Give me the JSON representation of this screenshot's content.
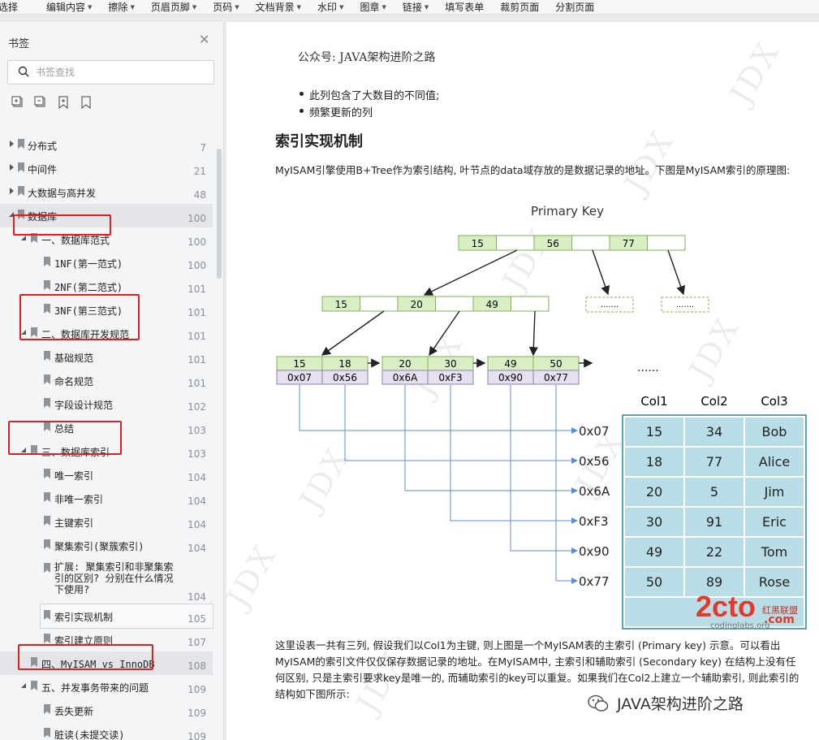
{
  "toolbar": {
    "items": [
      {
        "label": "选择",
        "caret": false
      },
      {
        "label": "编辑内容",
        "caret": true
      },
      {
        "label": "擦除",
        "caret": true
      },
      {
        "label": "页眉页脚",
        "caret": true
      },
      {
        "label": "页码",
        "caret": true
      },
      {
        "label": "文档背景",
        "caret": true
      },
      {
        "label": "水印",
        "caret": true
      },
      {
        "label": "图章",
        "caret": true
      },
      {
        "label": "链接",
        "caret": true
      },
      {
        "label": "填写表单",
        "caret": false
      },
      {
        "label": "裁剪页面",
        "caret": false
      },
      {
        "label": "分割页面",
        "caret": false
      }
    ]
  },
  "sidebar": {
    "title": "书签",
    "search_placeholder": "书签查找",
    "tools": [
      "expand-all-icon",
      "collapse-all-icon",
      "add-bookmark-icon",
      "delete-bookmark-icon"
    ],
    "items": [
      {
        "label": "分布式",
        "page": "7",
        "level": 0,
        "arrow": "right"
      },
      {
        "label": "中间件",
        "page": "21",
        "level": 0,
        "arrow": "right"
      },
      {
        "label": "大数据与高并发",
        "page": "48",
        "level": 0,
        "arrow": "right"
      },
      {
        "label": "数据库",
        "page": "100",
        "level": 0,
        "arrow": "down",
        "selected": true
      },
      {
        "label": "一、数据库范式",
        "page": "100",
        "level": 1,
        "arrow": "down"
      },
      {
        "label": "1NF(第一范式)",
        "page": "100",
        "level": 2
      },
      {
        "label": "2NF(第二范式)",
        "page": "101",
        "level": 2
      },
      {
        "label": "3NF(第三范式)",
        "page": "101",
        "level": 2
      },
      {
        "label": "二、数据库开发规范",
        "page": "101",
        "level": 1,
        "arrow": "down"
      },
      {
        "label": "基础规范",
        "page": "101",
        "level": 2
      },
      {
        "label": "命名规范",
        "page": "101",
        "level": 2
      },
      {
        "label": "字段设计规范",
        "page": "102",
        "level": 2
      },
      {
        "label": "总结",
        "page": "103",
        "level": 2
      },
      {
        "label": "三、数据库索引",
        "page": "103",
        "level": 1,
        "arrow": "down"
      },
      {
        "label": "唯一索引",
        "page": "104",
        "level": 2
      },
      {
        "label": "非唯一索引",
        "page": "104",
        "level": 2
      },
      {
        "label": "主键索引",
        "page": "104",
        "level": 2
      },
      {
        "label": "聚集索引(聚簇索引)",
        "page": "104",
        "level": 2
      },
      {
        "label": "扩展: 聚集索引和非聚集索引的区别? 分别在什么情况下使用?",
        "page": "104",
        "level": 2,
        "multi": true
      },
      {
        "label": "索引实现机制",
        "page": "105",
        "level": 2,
        "hover": true
      },
      {
        "label": "索引建立原则",
        "page": "107",
        "level": 2
      },
      {
        "label": "四、MyISAM vs InnoDB",
        "page": "108",
        "level": 1,
        "selected": true
      },
      {
        "label": "五、并发事务带来的问题",
        "page": "109",
        "level": 1,
        "arrow": "down"
      },
      {
        "label": "丢失更新",
        "page": "109",
        "level": 2
      },
      {
        "label": "脏读(未提交读)",
        "page": "109",
        "level": 2
      }
    ]
  },
  "page": {
    "account_line": "公众号: JAVA架构进阶之路",
    "bullets": [
      "此列包含了大数目的不同值;",
      "频繁更新的列"
    ],
    "heading": "索引实现机制",
    "intro": "MyISAM引擎使用B+Tree作为索引结构, 叶节点的data域存放的是数据记录的地址。下图是MyISAM索引的原理图:",
    "body": "这里设表一共有三列, 假设我们以Col1为主键, 则上图是一个MyISAM表的主索引 (Primary key) 示意。可以看出MyISAM的索引文件仅仅保存数据记录的地址。在MyISAM中, 主索引和辅助索引 (Secondary key) 在结构上没有任何区别, 只是主索引要求key是唯一的, 而辅助索引的key可以重复。如果我们在Col2上建立一个辅助索引, 则此索引的结构如下图所示:",
    "footer": "JAVA架构进阶之路",
    "watermark": "JDX"
  },
  "figure": {
    "title": "Primary Key",
    "root_keys": [
      "15",
      "56",
      "77"
    ],
    "mid_keys": [
      "15",
      "20",
      "49"
    ],
    "ellipsis": ".......",
    "more": "......",
    "leaves": [
      {
        "keys": [
          "15",
          "18"
        ],
        "addrs": [
          "0x07",
          "0x56"
        ]
      },
      {
        "keys": [
          "20",
          "30"
        ],
        "addrs": [
          "0x6A",
          "0xF3"
        ]
      },
      {
        "keys": [
          "49",
          "50"
        ],
        "addrs": [
          "0x90",
          "0x77"
        ]
      }
    ],
    "addresses": [
      "0x07",
      "0x56",
      "0x6A",
      "0xF3",
      "0x90",
      "0x77"
    ],
    "table": {
      "columns": [
        "Col1",
        "Col2",
        "Col3"
      ],
      "rows": [
        [
          "15",
          "34",
          "Bob"
        ],
        [
          "18",
          "77",
          "Alice"
        ],
        [
          "20",
          "5",
          "Jim"
        ],
        [
          "30",
          "91",
          "Eric"
        ],
        [
          "49",
          "22",
          "Tom"
        ],
        [
          "50",
          "89",
          "Rose"
        ]
      ]
    },
    "stamp": {
      "brand": "2cto",
      "tag": "红黑联盟",
      "url": "codinglabs.org",
      "suffix": ".com"
    },
    "colors": {
      "node_fill": "#d8efc4",
      "node_stroke": "#7fb356",
      "addr_fill": "#e6e0f0",
      "table_fill": "#b9dde6",
      "table_stroke": "#2f8ca8",
      "line_blue": "#5b8bd6"
    }
  }
}
